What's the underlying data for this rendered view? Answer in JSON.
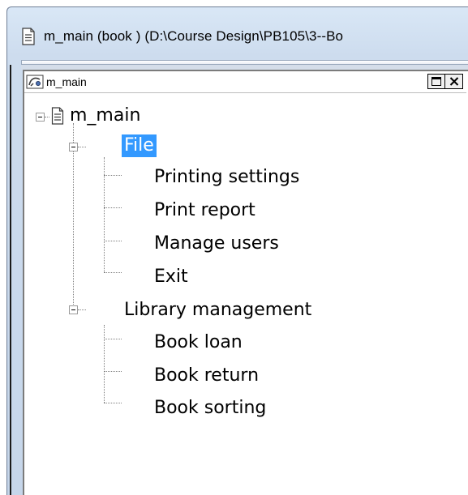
{
  "window": {
    "title": "m_main (book ) (D:\\Course Design\\PB105\\3--Bo"
  },
  "pane": {
    "caption": "m_main"
  },
  "tree": {
    "root": "m_main",
    "groups": [
      {
        "label": "File",
        "selected": true,
        "items": [
          "Printing settings",
          "Print report",
          "Manage users",
          "Exit"
        ]
      },
      {
        "label": "Library management",
        "selected": false,
        "items": [
          "Book loan",
          "Book return",
          "Book sorting"
        ]
      }
    ]
  },
  "colors": {
    "selection": "#3399ff",
    "frame": "#c6d6ea"
  },
  "icons": {
    "window": "document-icon",
    "pane": "menu-painter-icon",
    "root": "document-icon",
    "maximize": "maximize-icon",
    "close": "close-icon"
  }
}
